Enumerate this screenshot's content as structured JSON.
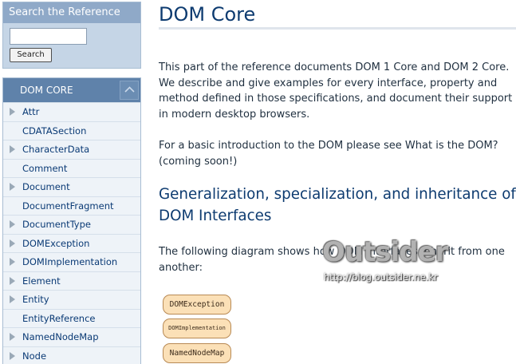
{
  "search": {
    "title": "Search the Reference",
    "input_value": "",
    "button_label": "Search"
  },
  "nav": {
    "header": "DOM CORE",
    "items": [
      {
        "label": "Attr",
        "has_children": true
      },
      {
        "label": "CDATASection",
        "has_children": false
      },
      {
        "label": "CharacterData",
        "has_children": true
      },
      {
        "label": "Comment",
        "has_children": false
      },
      {
        "label": "Document",
        "has_children": true
      },
      {
        "label": "DocumentFragment",
        "has_children": false
      },
      {
        "label": "DocumentType",
        "has_children": true
      },
      {
        "label": "DOMException",
        "has_children": true
      },
      {
        "label": "DOMImplementation",
        "has_children": true
      },
      {
        "label": "Element",
        "has_children": true
      },
      {
        "label": "Entity",
        "has_children": true
      },
      {
        "label": "EntityReference",
        "has_children": false
      },
      {
        "label": "NamedNodeMap",
        "has_children": true
      },
      {
        "label": "Node",
        "has_children": true
      }
    ]
  },
  "main": {
    "title": "DOM Core",
    "intro": "This part of the reference documents DOM 1 Core and DOM 2 Core. We describe and give examples for every interface, property and method defined in those specifications, and document their support in modern desktop browsers.",
    "basic": "For a basic introduction to the DOM please see What is the DOM? (coming soon!)",
    "section_heading": "Generalization, specialization, and inheritance of DOM Interfaces",
    "diagram_intro": "The following diagram shows how DOM interfaces inherit from one another:",
    "diagram_nodes": [
      "DOMException",
      "DOMImplementation",
      "NamedNodeMap"
    ]
  },
  "watermark": {
    "logo_text": "Outsider",
    "url": "http://blog.outsider.ne.kr"
  }
}
